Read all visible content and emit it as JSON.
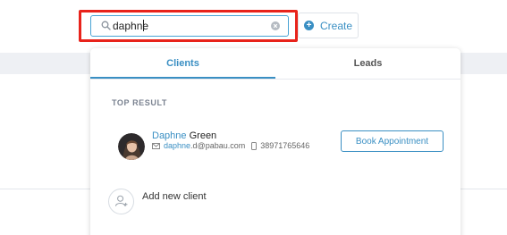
{
  "search": {
    "value": "daphne",
    "icon": "search-icon",
    "clear_icon": "clear-icon"
  },
  "create_button": {
    "label": "Create",
    "icon": "plus-circle-icon"
  },
  "tabs": [
    {
      "label": "Clients",
      "active": true
    },
    {
      "label": "Leads",
      "active": false
    }
  ],
  "section_label": "TOP RESULT",
  "result": {
    "first_name_match": "Daphne",
    "last_name": " Green",
    "email_match": "daphne",
    "email_rest": ".d@pabau.com",
    "phone": "38971765646",
    "book_button": "Book Appointment"
  },
  "add_new_client": "Add new client",
  "colors": {
    "accent": "#3a8fc3",
    "highlight_border": "#e8231b"
  }
}
